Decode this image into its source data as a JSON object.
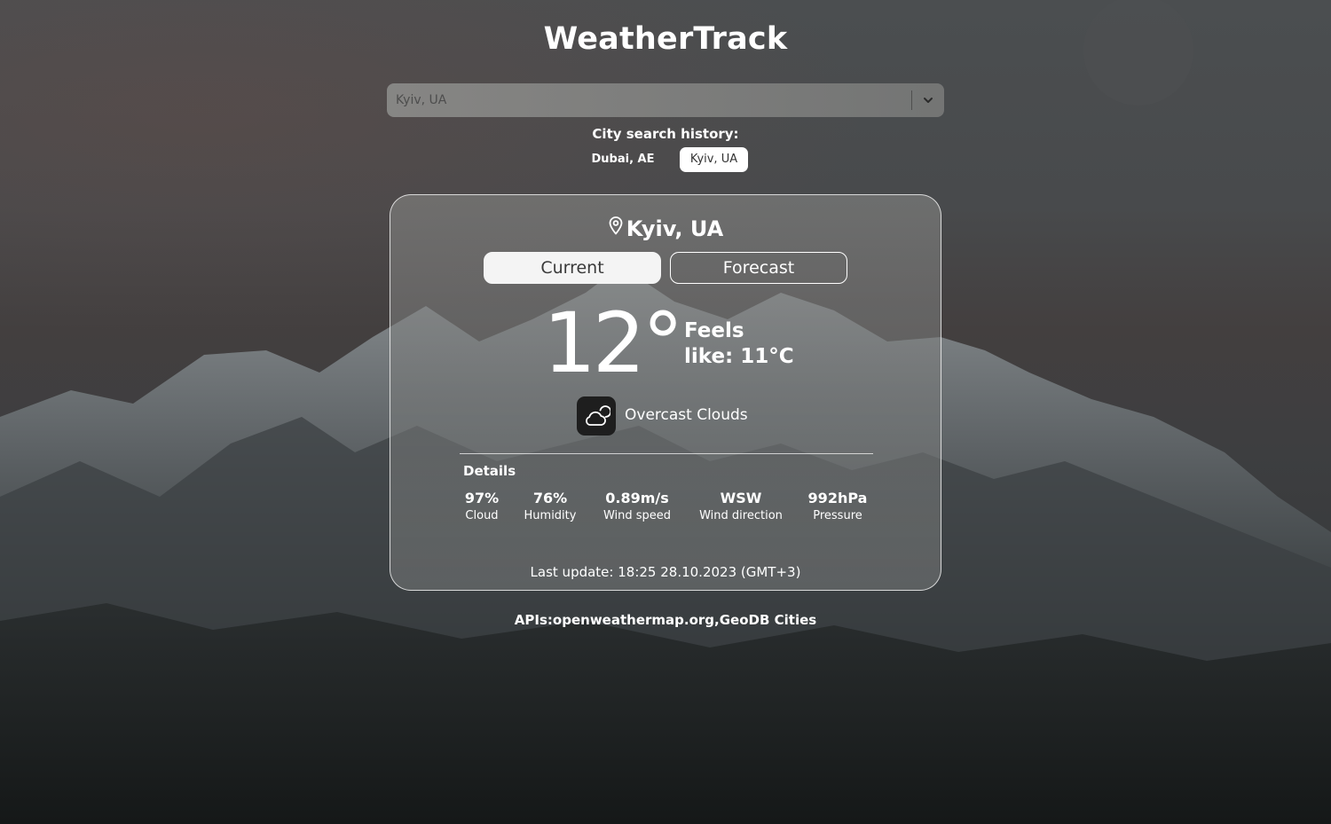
{
  "app": {
    "title": "WeatherTrack"
  },
  "search": {
    "placeholder": "Kyiv, UA",
    "value": "",
    "dropdown_icon": "chevron-down-icon"
  },
  "history": {
    "label": "City search history:",
    "items": [
      {
        "label": "Dubai, AE",
        "selected": false
      },
      {
        "label": "Kyiv, UA",
        "selected": true
      }
    ]
  },
  "weather": {
    "location": "Kyiv, UA",
    "location_icon": "map-pin-icon",
    "tabs": [
      {
        "label": "Current",
        "active": true
      },
      {
        "label": "Forecast",
        "active": false
      }
    ],
    "temperature": "12°",
    "feels_like": "Feels like: 11°C",
    "condition": "Overcast Clouds",
    "condition_icon": "cloud-sun-icon",
    "details_title": "Details",
    "details": [
      {
        "value": "97%",
        "label": "Cloud"
      },
      {
        "value": "76%",
        "label": "Humidity"
      },
      {
        "value": "0.89m/s",
        "label": "Wind speed"
      },
      {
        "value": "WSW",
        "label": "Wind direction"
      },
      {
        "value": "992hPa",
        "label": "Pressure"
      }
    ],
    "last_update": "Last update: 18:25 28.10.2023 (GMT+3)"
  },
  "footer": {
    "prefix": "APIs:",
    "links": [
      "openweathermap.org",
      "GeoDB Cities"
    ],
    "separator": ","
  },
  "colors": {
    "background": "#3a3d3e",
    "chip_selected_bg": "#ffffff",
    "tab_active_bg": "#f4f4f4",
    "icon_tile_bg": "#1e1e1e"
  }
}
